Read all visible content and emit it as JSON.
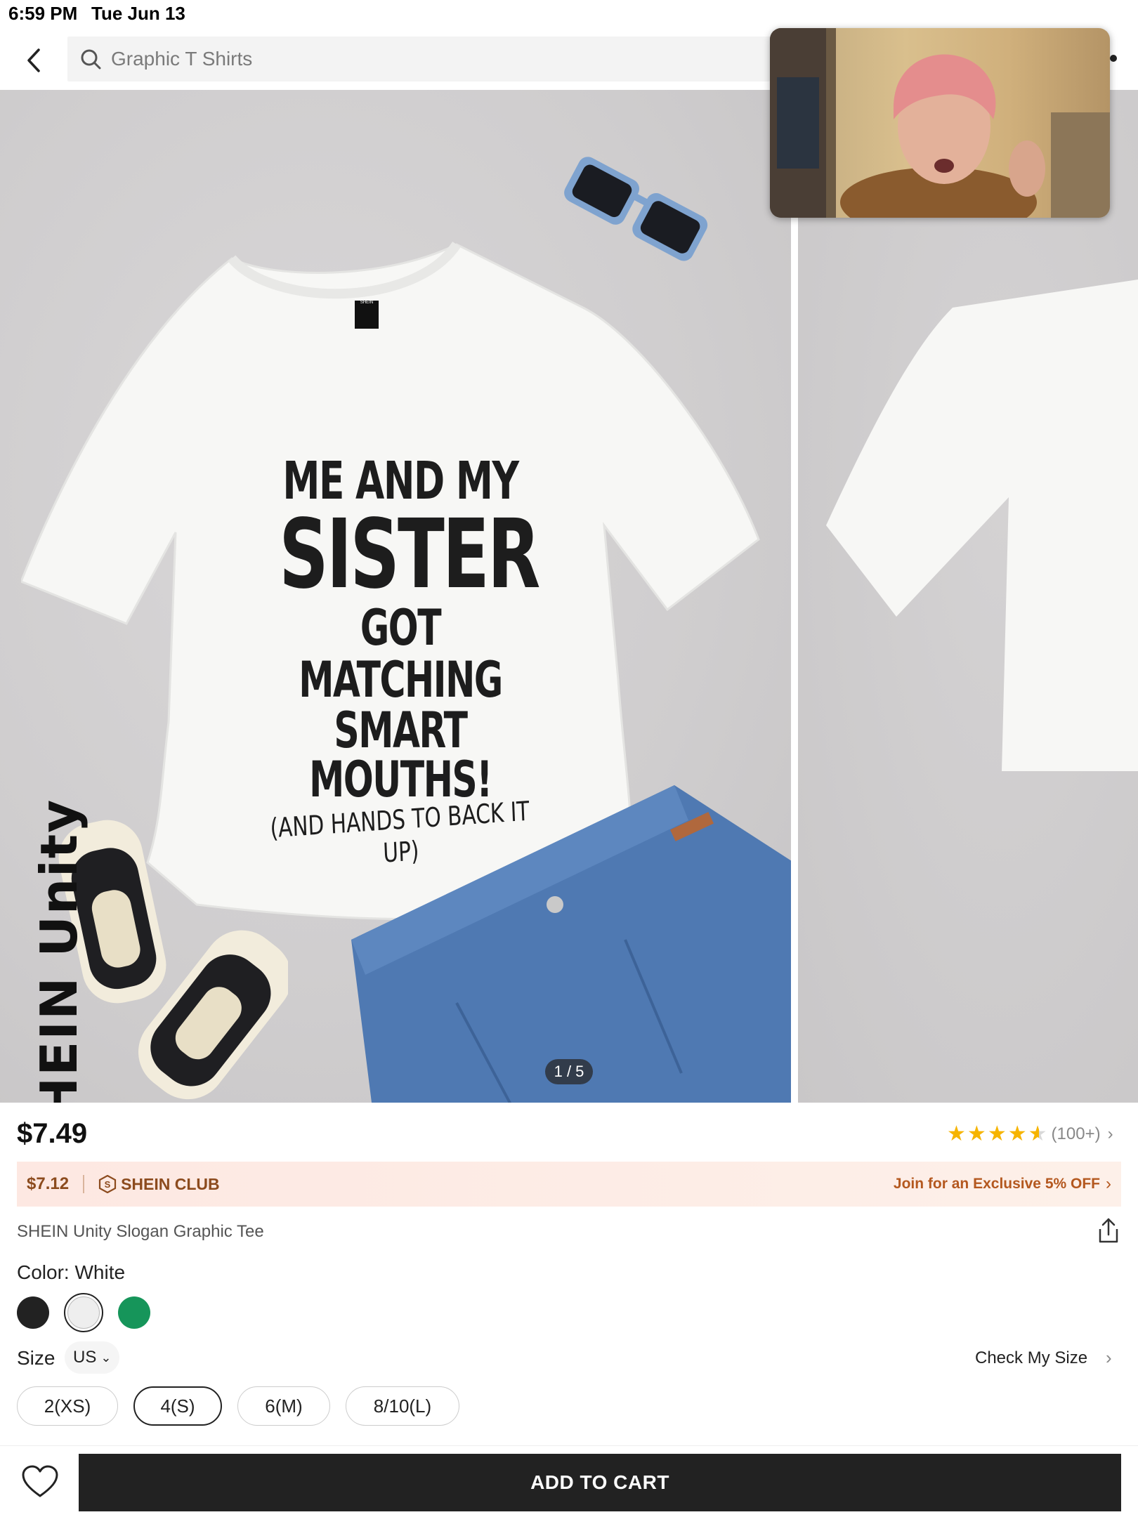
{
  "status_bar": {
    "time": "6:59 PM",
    "date": "Tue Jun 13"
  },
  "header": {
    "search_placeholder": "Graphic T Shirts"
  },
  "gallery": {
    "shirt_print": [
      "ME AND MY",
      "SISTER",
      "GOT MATCHING",
      "SMART MOUTHS!",
      "(AND HANDS TO BACK IT UP)"
    ],
    "shirt_tag": "SHEIN",
    "watermark": "SHEIN Unity",
    "page_indicator": "1 / 5"
  },
  "product": {
    "price": "$7.49",
    "rating_stars": 4.5,
    "review_count": "(100+)",
    "club": {
      "price": "$7.12",
      "name": "SHEIN CLUB",
      "cta": "Join for an Exclusive 5% OFF"
    },
    "title": "SHEIN Unity Slogan Graphic Tee",
    "color_label": "Color: White",
    "swatches": [
      {
        "name": "Black",
        "hex": "#222222"
      },
      {
        "name": "White",
        "hex": "#eeeeee"
      },
      {
        "name": "Green",
        "hex": "#16955a"
      }
    ],
    "size_label": "Size",
    "size_unit": "US",
    "check_size": "Check My Size",
    "sizes": [
      "2(XS)",
      "4(S)",
      "6(M)",
      "8/10(L)"
    ],
    "selected_size": "4(S)"
  },
  "footer": {
    "add_to_cart": "ADD TO CART"
  },
  "colors": {
    "star": "#f6b400",
    "club_text": "#8c4b1e",
    "cta_bg": "#222222"
  }
}
